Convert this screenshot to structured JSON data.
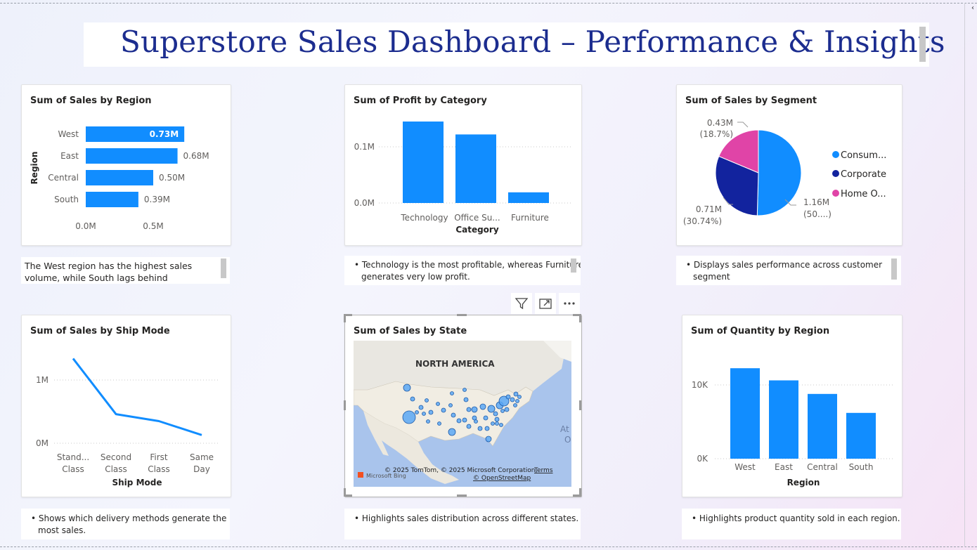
{
  "dashboard": {
    "title": "Superstore Sales Dashboard – Performance & Insights"
  },
  "cards": {
    "region_sales": {
      "title": "Sum of Sales by Region",
      "y_axis_label": "Region",
      "categories": [
        "West",
        "East",
        "Central",
        "South"
      ],
      "value_labels": [
        "0.73M",
        "0.68M",
        "0.50M",
        "0.39M"
      ],
      "x_ticks": [
        "0.0M",
        "0.5M"
      ],
      "note": "The West region has the highest sales volume, while South lags behind"
    },
    "profit_category": {
      "title": "Sum of Profit by Category",
      "x_axis_label": "Category",
      "categories": [
        "Technology",
        "Office Su...",
        "Furniture"
      ],
      "y_ticks": [
        "0.1M",
        "0.0M"
      ],
      "note_line1": "• Technology is the most profitable, whereas Furniture",
      "note_line2": "generates very low profit."
    },
    "segment_sales": {
      "title": "Sum of Sales by Segment",
      "legend": [
        "Consum...",
        "Corporate",
        "Home O..."
      ],
      "slice_labels": {
        "consumer_value": "1.16M",
        "consumer_pct": "(50....)",
        "corporate_value": "0.71M",
        "corporate_pct": "(30.74%)",
        "home_value": "0.43M",
        "home_pct": "(18.7%)"
      },
      "note_line1": "• Displays sales performance across customer",
      "note_line2": "segment"
    },
    "ship_mode": {
      "title": "Sum of Sales by Ship Mode",
      "x_axis_label": "Ship Mode",
      "y_ticks": [
        "1M",
        "0M"
      ],
      "categories_line1": [
        "Stand...",
        "Second",
        "First",
        "Same"
      ],
      "categories_line2": [
        "Class",
        "Class",
        "Class",
        "Day"
      ],
      "note_line1": "• Shows which delivery methods generate the",
      "note_line2": "most sales."
    },
    "state_map": {
      "title": "Sum of Sales by State",
      "map_label": "NORTH AMERICA",
      "ocean_label_1": "At",
      "ocean_label_2": "O",
      "attribution": "© 2025 TomTom, © 2025 Microsoft Corporation,",
      "terms": "Terms",
      "osm": "© OpenStreetMap",
      "bing": "Microsoft Bing",
      "note": "• Highlights sales distribution across different states."
    },
    "quantity_region": {
      "title": "Sum of Quantity by Region",
      "x_axis_label": "Region",
      "categories": [
        "West",
        "East",
        "Central",
        "South"
      ],
      "y_ticks": [
        "10K",
        "0K"
      ],
      "note": "• Highlights product quantity sold in each region."
    }
  },
  "chart_data": [
    {
      "type": "bar",
      "orientation": "horizontal",
      "title": "Sum of Sales by Region",
      "ylabel": "Region",
      "categories": [
        "West",
        "East",
        "Central",
        "South"
      ],
      "values": [
        0.73,
        0.68,
        0.5,
        0.39
      ],
      "unit": "M",
      "xlim": [
        0,
        0.75
      ]
    },
    {
      "type": "bar",
      "title": "Sum of Profit by Category",
      "xlabel": "Category",
      "categories": [
        "Technology",
        "Office Su...",
        "Furniture"
      ],
      "values": [
        0.145,
        0.122,
        0.019
      ],
      "unit": "M",
      "ylim": [
        0,
        0.15
      ]
    },
    {
      "type": "pie",
      "title": "Sum of Sales by Segment",
      "categories": [
        "Consum...",
        "Corporate",
        "Home O..."
      ],
      "values": [
        1.16,
        0.71,
        0.43
      ],
      "percents": [
        50.56,
        30.74,
        18.7
      ],
      "colors": [
        "#118dff",
        "#12239e",
        "#e044a7"
      ]
    },
    {
      "type": "line",
      "title": "Sum of Sales by Ship Mode",
      "xlabel": "Ship Mode",
      "categories": [
        "Standard Class",
        "Second Class",
        "First Class",
        "Same Day"
      ],
      "values": [
        1.34,
        0.46,
        0.35,
        0.13
      ],
      "unit": "M",
      "ylim": [
        0,
        1.4
      ]
    },
    {
      "type": "bar",
      "title": "Sum of Quantity by Region",
      "xlabel": "Region",
      "categories": [
        "West",
        "East",
        "Central",
        "South"
      ],
      "values": [
        12266,
        10618,
        8780,
        6209
      ],
      "ylim": [
        0,
        12500
      ]
    }
  ],
  "colors": {
    "accent": "#118dff",
    "title": "#1c2d8f",
    "corporate": "#12239e",
    "home_office": "#e044a7"
  }
}
